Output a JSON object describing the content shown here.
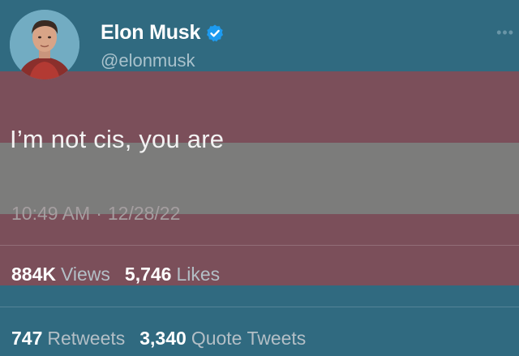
{
  "author": {
    "display_name": "Elon Musk",
    "handle": "@elonmusk",
    "verified": true,
    "avatar": "avatar-photo",
    "verified_icon": "verified-badge-icon"
  },
  "tweet": {
    "text": "I’m not cis, you are",
    "time": "10:49 AM",
    "separator": "·",
    "date": "12/28/22"
  },
  "stats": {
    "views_count": "884K",
    "views_label": "Views",
    "likes_count": "5,746",
    "likes_label": "Likes",
    "retweets_count": "747",
    "retweets_label": "Retweets",
    "quotes_count": "3,340",
    "quotes_label": "Quote Tweets"
  },
  "colors": {
    "background_blue": "#306a80",
    "stripe_pink": "#7b4f5a",
    "stripe_white": "#7c7c7b",
    "verified_blue": "#1d9bf0"
  }
}
